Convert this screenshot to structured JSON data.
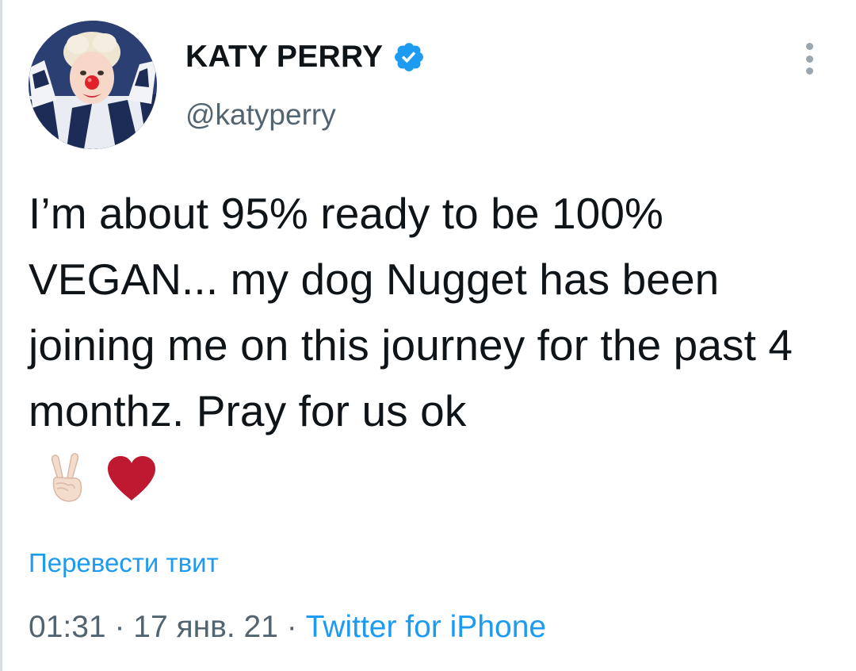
{
  "author": {
    "display_name": "KATY PERRY",
    "handle": "@katyperry",
    "verified": true,
    "verified_color": "#1d9bf0"
  },
  "tweet": {
    "text": "I’m about 95% ready to be 100% VEGAN... my dog Nugget has been joining me on this journey for the past 4 monthz. Pray for us ok",
    "emojis": [
      "victory-hand-light-skin",
      "red-heart"
    ]
  },
  "actions": {
    "translate_label": "Перевести твит",
    "more_icon": "more-vertical-icon"
  },
  "meta": {
    "time": "01:31",
    "separator": " · ",
    "date": "17 янв. 21",
    "source": "Twitter for iPhone"
  },
  "colors": {
    "text": "#0f1419",
    "secondary": "#536471",
    "link": "#1d9bf0",
    "heart": "#be1931"
  }
}
